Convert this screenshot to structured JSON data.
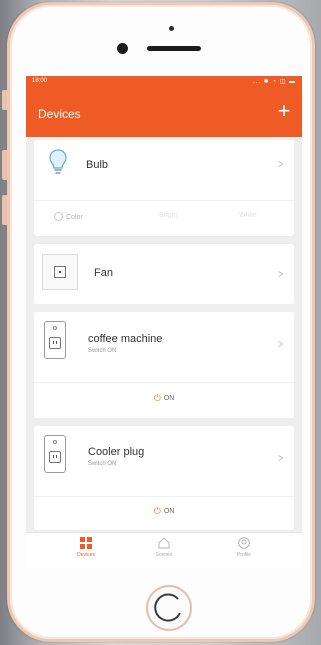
{
  "status_bar": {
    "time": "18:00",
    "icons": "... ✱ ◔ ◫ ▬"
  },
  "header": {
    "title": "Devices",
    "add_label": "+"
  },
  "devices": [
    {
      "name": "Bulb",
      "controls": [
        {
          "label": "Color",
          "icon": "color-circle-icon"
        },
        {
          "label": "Bright"
        },
        {
          "label": "White"
        }
      ]
    },
    {
      "name": "Fan"
    },
    {
      "name": "coffee machine",
      "status": "Switch ON",
      "toggle_label": "ON"
    },
    {
      "name": "Cooler plug",
      "status": "Switch ON",
      "toggle_label": "ON"
    }
  ],
  "tabs": [
    {
      "label": "Devices",
      "icon": "grid-icon",
      "active": true
    },
    {
      "label": "Scenes",
      "icon": "home-outline-icon",
      "active": false
    },
    {
      "label": "Profile",
      "icon": "profile-icon",
      "active": false
    }
  ],
  "colors": {
    "accent": "#ee5b24",
    "power_icon": "#f07a2c",
    "phone_trim": "#ecc9b4"
  }
}
